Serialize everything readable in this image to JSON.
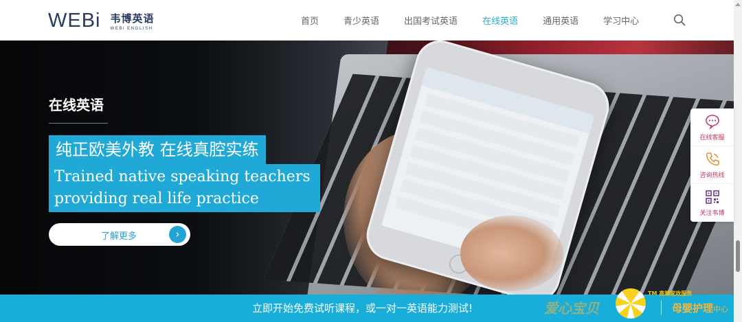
{
  "header": {
    "logo_text": "WEBi",
    "logo_cn": "韦博英语",
    "logo_en": "WEBi ENGLISH",
    "nav": [
      {
        "label": "首页"
      },
      {
        "label": "青少英语"
      },
      {
        "label": "出国考试英语"
      },
      {
        "label": "在线英语",
        "active": true
      },
      {
        "label": "通用英语"
      },
      {
        "label": "学习中心"
      }
    ],
    "search_icon": "search-icon"
  },
  "hero": {
    "title": "在线英语",
    "tagline_cn": "纯正欧美外教 在线真腔实练",
    "tagline_en_line1": "Trained native speaking teachers",
    "tagline_en_line2": "providing real life practice",
    "button_label": "了解更多",
    "button_icon": "chevron-right-icon",
    "accent_color": "#20a9d6"
  },
  "side_bar": [
    {
      "label": "在线客服",
      "icon": "chat-bubble-icon"
    },
    {
      "label": "咨询热线",
      "icon": "phone-icon"
    },
    {
      "label": "关注韦博",
      "icon": "qr-code-icon"
    }
  ],
  "cta": {
    "text": "立即开始免费试听课程，或一对一英语能力测试!",
    "background": "#18aed9"
  },
  "watermark": {
    "left_text": "爱心宝贝",
    "tm_text": "TM 高端家政服务",
    "right_text": "母婴护理",
    "right_small": "中心"
  }
}
